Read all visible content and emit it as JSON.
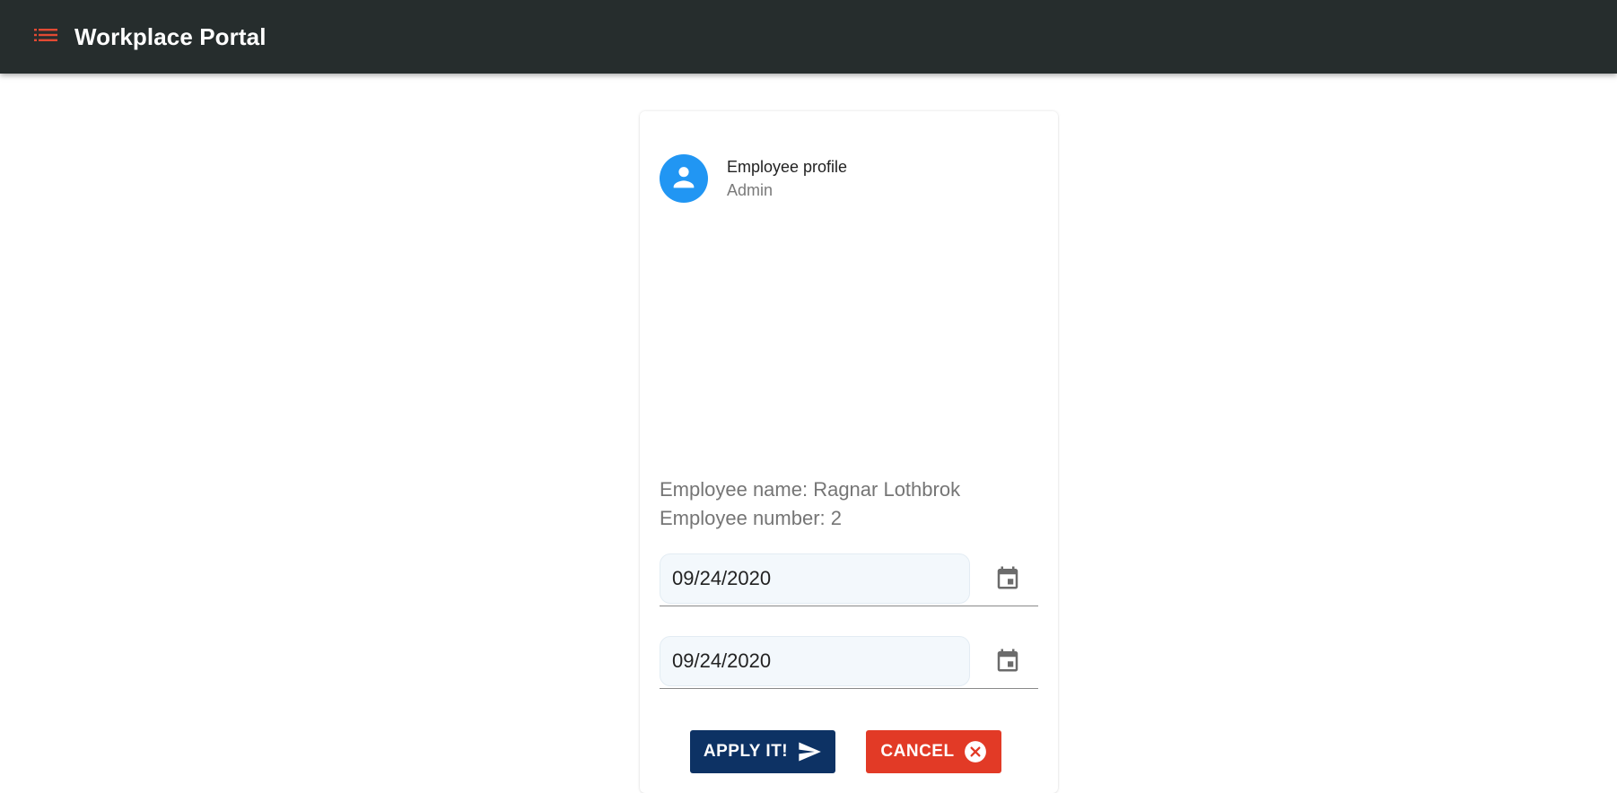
{
  "appbar": {
    "title": "Workplace Portal",
    "menu_icon": "list-icon",
    "accent_color": "#e24a33",
    "background_color": "#262d2d"
  },
  "profile": {
    "title": "Employee profile",
    "subtitle": "Admin",
    "avatar_icon": "person-icon",
    "avatar_color": "#2196f3"
  },
  "employee": {
    "name_line": "Employee name: Ragnar Lothbrok",
    "number_line": "Employee number: 2"
  },
  "dates": {
    "start_value": "09/24/2020",
    "end_value": "09/24/2020",
    "icon": "calendar-icon"
  },
  "actions": {
    "apply_label": "APPLY IT!",
    "apply_icon": "send-icon",
    "apply_color": "#0d3264",
    "cancel_label": "CANCEL",
    "cancel_icon": "cancel-circle-icon",
    "cancel_color": "#e23a26"
  }
}
